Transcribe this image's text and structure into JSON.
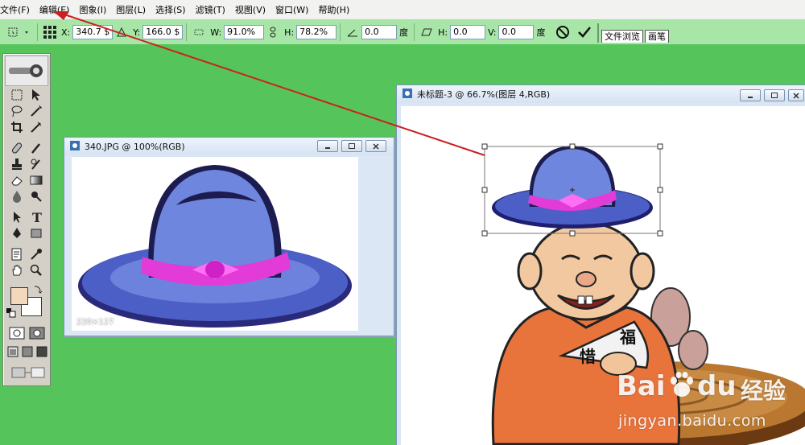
{
  "menubar": {
    "items": [
      "文件(F)",
      "编辑(E)",
      "图象(I)",
      "图层(L)",
      "选择(S)",
      "滤镜(T)",
      "视图(V)",
      "窗口(W)",
      "帮助(H)"
    ]
  },
  "options_bar": {
    "x_label": "X:",
    "x_value": "340.7 $",
    "y_label": "Y:",
    "y_value": "166.0 $",
    "w_label": "W:",
    "w_value": "91.0%",
    "h_label": "H:",
    "h_value": "78.2%",
    "angle_value": "0.0",
    "angle_unit": "度",
    "skew_h_label": "H:",
    "skew_h_value": "0.0",
    "skew_v_label": "V:",
    "skew_v_value": "0.0",
    "skew_unit": "度",
    "palette_tabs": [
      "文件浏览",
      "画笔"
    ]
  },
  "doc_small": {
    "title": "340.JPG @ 100%(RGB)",
    "dimensions": "220×127"
  },
  "doc_large": {
    "title": "未标题-3 @ 66.7%(图层 4,RGB)"
  },
  "fan_text": {
    "char1": "惜",
    "char2": "福"
  },
  "watermark": {
    "brand_a": "Bai",
    "brand_b": "du",
    "cn": "经验",
    "url": "jingyan.baidu.com"
  },
  "colors": {
    "background": "#55c45a",
    "options_bar": "#a8e6a8",
    "arrow": "#cc2020",
    "foreground_swatch": "#f3d8bc",
    "background_swatch": "#ffffff"
  }
}
